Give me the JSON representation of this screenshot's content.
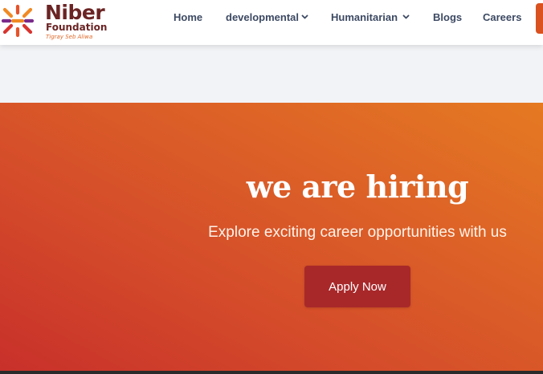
{
  "brand": {
    "name": "Niber",
    "subtitle": "Foundation",
    "tagline": "Tigray Seb Aliwa",
    "colors": {
      "primary": "#6b2424",
      "accent": "#e06a2a",
      "mark_red": "#d8342f",
      "mark_orange": "#f08a24",
      "mark_purple": "#7a2b8c"
    }
  },
  "nav": {
    "items": [
      {
        "label": "Home",
        "has_dropdown": false
      },
      {
        "label": "developmental",
        "has_dropdown": true,
        "icon": "chevron-down-icon"
      },
      {
        "label": "Humanitarian",
        "has_dropdown": true,
        "icon": "chevron-down-icon"
      },
      {
        "label": "Blogs",
        "has_dropdown": false
      },
      {
        "label": "Careers",
        "has_dropdown": false
      }
    ],
    "text_color": "#3d4a63"
  },
  "hero": {
    "title": "we are hiring",
    "subtitle": "Explore exciting career opportunities with us",
    "cta_label": "Apply Now",
    "colors": {
      "gradient_start": "#c8302a",
      "gradient_end": "#e57a22",
      "button": "#a8282a"
    }
  }
}
